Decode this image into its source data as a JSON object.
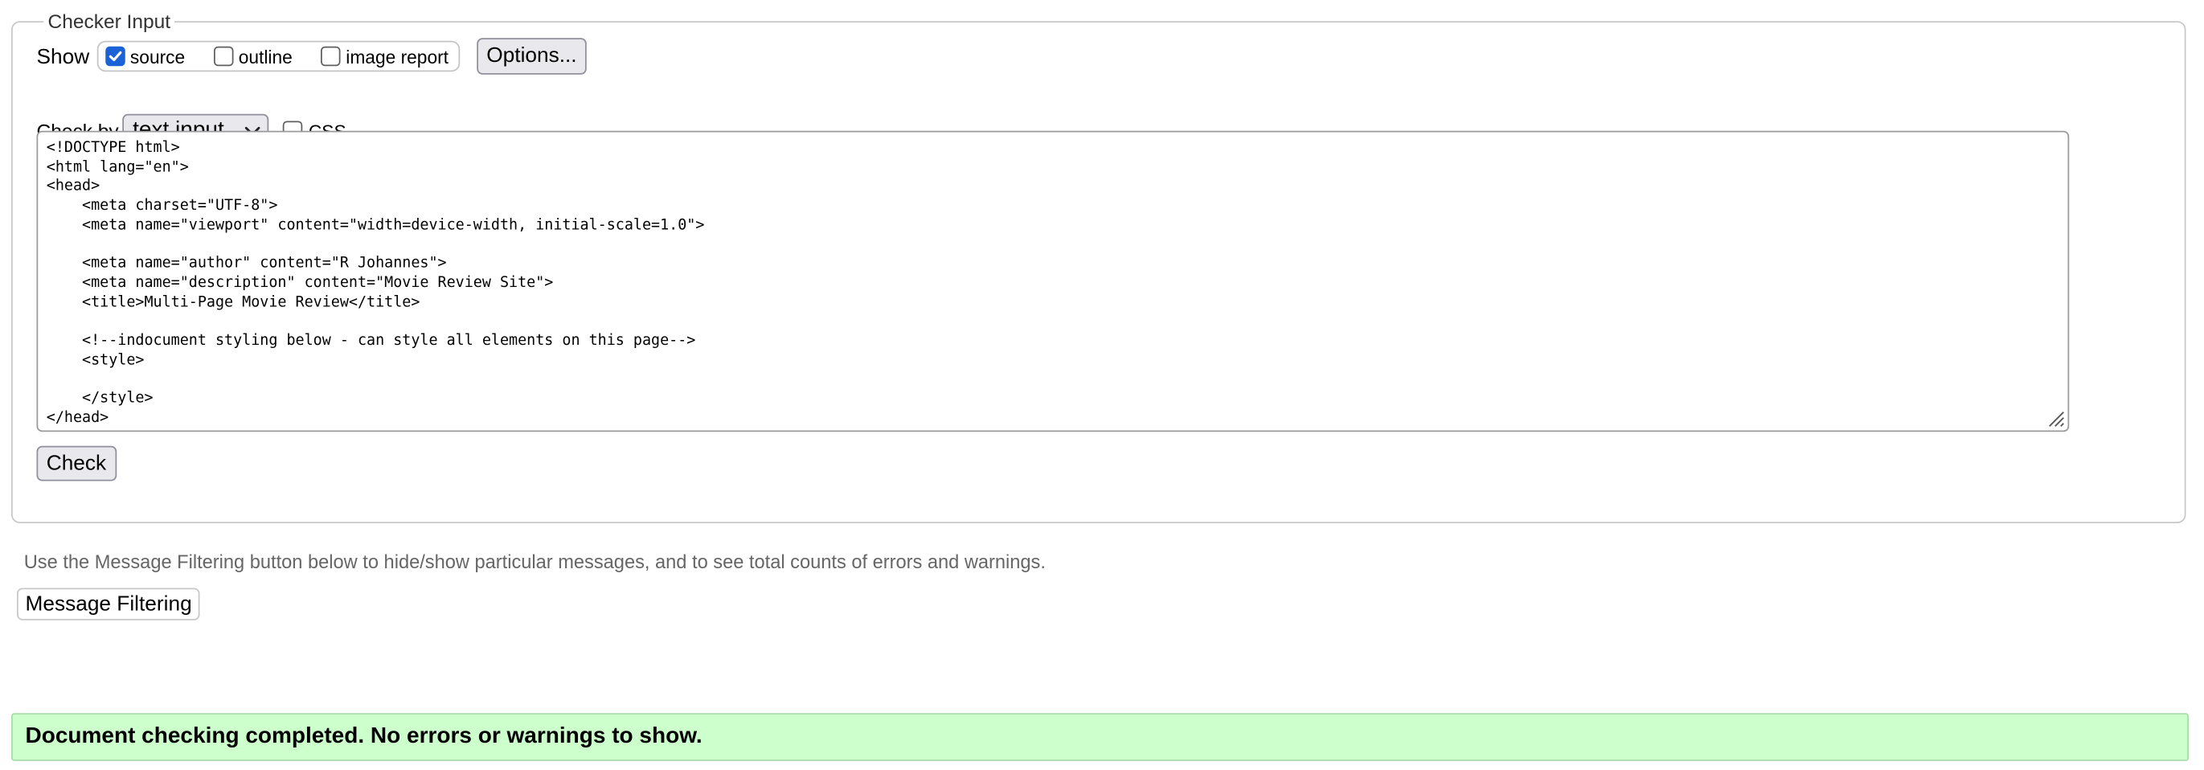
{
  "fieldset": {
    "legend": "Checker Input"
  },
  "show": {
    "label": "Show",
    "options": [
      {
        "label": "source",
        "checked": true
      },
      {
        "label": "outline",
        "checked": false
      },
      {
        "label": "image report",
        "checked": false
      }
    ],
    "options_button": "Options..."
  },
  "checkby": {
    "label": "Check by",
    "selected": "text input",
    "css_label": "CSS",
    "css_checked": false
  },
  "source_code": "<!DOCTYPE html>\n<html lang=\"en\">\n<head>\n    <meta charset=\"UTF-8\">\n    <meta name=\"viewport\" content=\"width=device-width, initial-scale=1.0\">\n\n    <meta name=\"author\" content=\"R Johannes\">\n    <meta name=\"description\" content=\"Movie Review Site\">\n    <title>Multi-Page Movie Review</title>\n\n    <!--indocument styling below - can style all elements on this page-->\n    <style>\n\n    </style>\n</head>",
  "check_button": "Check",
  "filter": {
    "info": "Use the Message Filtering button below to hide/show particular messages, and to see total counts of errors and warnings.",
    "button": "Message Filtering"
  },
  "result": {
    "message": "Document checking completed. No errors or warnings to show."
  },
  "colors": {
    "success_bg": "#ccffcc",
    "checkbox_accent": "#1a62d6",
    "button_bg": "#e9e9ed"
  }
}
